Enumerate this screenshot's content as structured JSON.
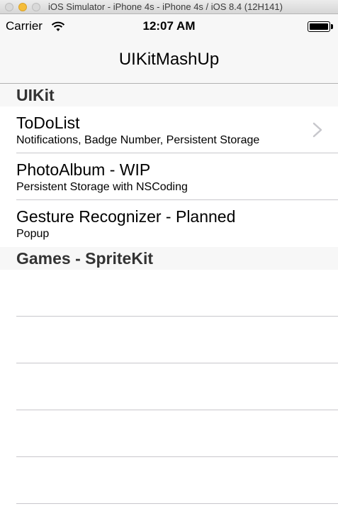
{
  "window": {
    "title": "iOS Simulator - iPhone 4s - iPhone 4s / iOS 8.4 (12H141)"
  },
  "status_bar": {
    "carrier": "Carrier",
    "time": "12:07 AM",
    "icons": [
      "wifi-icon",
      "battery-icon"
    ]
  },
  "nav": {
    "title": "UIKitMashUp"
  },
  "sections": [
    {
      "header": "UIKit",
      "rows": [
        {
          "title": "ToDoList",
          "subtitle": "Notifications, Badge Number, Persistent Storage",
          "accessory": "chevron-right-icon"
        },
        {
          "title": "PhotoAlbum - WIP",
          "subtitle": "Persistent Storage with NSCoding"
        },
        {
          "title": "Gesture Recognizer - Planned",
          "subtitle": "Popup"
        }
      ]
    },
    {
      "header": "Games - SpriteKit",
      "rows": []
    }
  ],
  "colors": {
    "bar_background": "#f7f7f7",
    "separator": "#c8c7cc",
    "chevron": "#c7c7cc",
    "minimize_button": "#f5bd39"
  }
}
